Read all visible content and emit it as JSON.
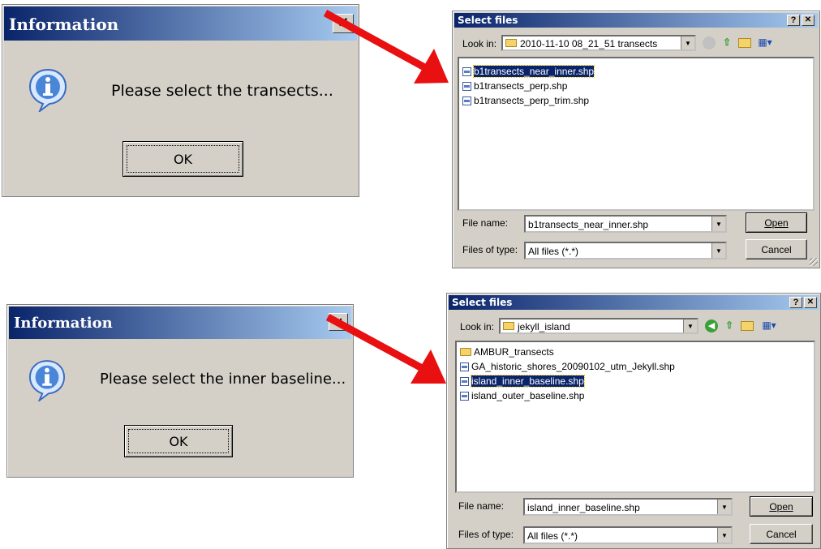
{
  "info_dialog_1": {
    "title": "Information",
    "close": "✕",
    "message": "Please select the transects...",
    "ok_label": "OK"
  },
  "info_dialog_2": {
    "title": "Information",
    "close": "✕",
    "message": "Please select the inner baseline...",
    "ok_label": "OK"
  },
  "file_dialog_1": {
    "title": "Select files",
    "help": "?",
    "close": "✕",
    "look_in_label": "Look in:",
    "look_in_value": "2010-11-10 08_21_51 transects",
    "files": [
      {
        "name": "b1transects_near_inner.shp",
        "kind": "file",
        "selected": true
      },
      {
        "name": "b1transects_perp.shp",
        "kind": "file",
        "selected": false
      },
      {
        "name": "b1transects_perp_trim.shp",
        "kind": "file",
        "selected": false
      }
    ],
    "file_name_label": "File name:",
    "file_name_value": "b1transects_near_inner.shp",
    "files_of_type_label": "Files of type:",
    "files_of_type_value": "All files (*.*)",
    "open_label": "Open",
    "cancel_label": "Cancel"
  },
  "file_dialog_2": {
    "title": "Select files",
    "help": "?",
    "close": "✕",
    "look_in_label": "Look in:",
    "look_in_value": "jekyll_island",
    "files": [
      {
        "name": "AMBUR_transects",
        "kind": "folder",
        "selected": false
      },
      {
        "name": "GA_historic_shores_20090102_utm_Jekyll.shp",
        "kind": "file",
        "selected": false
      },
      {
        "name": "island_inner_baseline.shp",
        "kind": "file",
        "selected": true
      },
      {
        "name": "island_outer_baseline.shp",
        "kind": "file",
        "selected": false
      }
    ],
    "file_name_label": "File name:",
    "file_name_value": "island_inner_baseline.shp",
    "files_of_type_label": "Files of type:",
    "files_of_type_value": "All files (*.*)",
    "open_label": "Open",
    "cancel_label": "Cancel"
  },
  "colors": {
    "arrow": "#e81010",
    "titlebar_start": "#0a246a",
    "titlebar_end": "#a6caf0",
    "dialog_bg": "#d4d0c8"
  }
}
